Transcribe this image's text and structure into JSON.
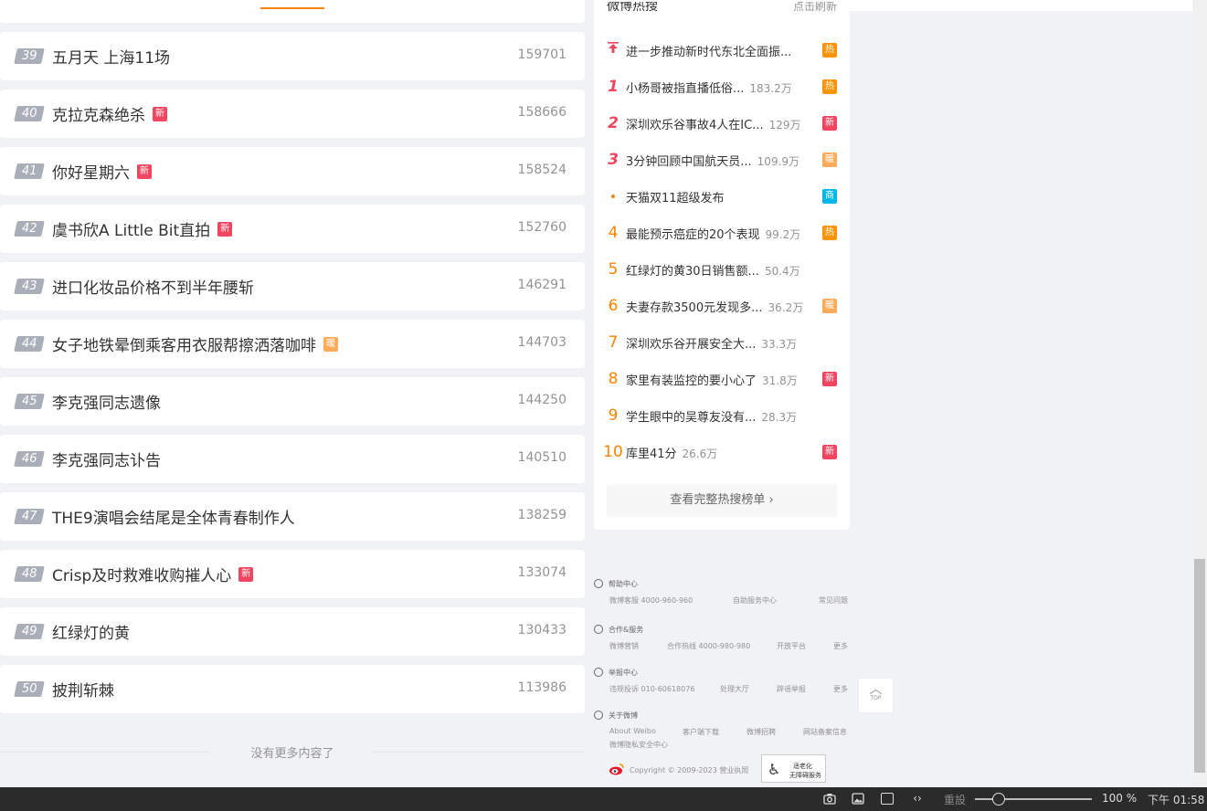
{
  "list": {
    "rows": [
      {
        "rank": "39",
        "title": "五月天 上海11场",
        "badge": "",
        "badge_type": "",
        "count": "159701"
      },
      {
        "rank": "40",
        "title": "克拉克森绝杀",
        "badge": "新",
        "badge_type": "b-new",
        "count": "158666"
      },
      {
        "rank": "41",
        "title": "你好星期六",
        "badge": "新",
        "badge_type": "b-new",
        "count": "158524"
      },
      {
        "rank": "42",
        "title": "虞书欣A Little Bit直拍",
        "badge": "新",
        "badge_type": "b-new",
        "count": "152760"
      },
      {
        "rank": "43",
        "title": "进口化妆品价格不到半年腰斩",
        "badge": "",
        "badge_type": "",
        "count": "146291"
      },
      {
        "rank": "44",
        "title": "女子地铁晕倒乘客用衣服帮擦洒落咖啡",
        "badge": "暖",
        "badge_type": "b-warm",
        "count": "144703"
      },
      {
        "rank": "45",
        "title": "李克强同志遗像",
        "badge": "",
        "badge_type": "",
        "count": "144250"
      },
      {
        "rank": "46",
        "title": "李克强同志讣告",
        "badge": "",
        "badge_type": "",
        "count": "140510"
      },
      {
        "rank": "47",
        "title": "THE9演唱会结尾是全体青春制作人",
        "badge": "",
        "badge_type": "",
        "count": "138259"
      },
      {
        "rank": "48",
        "title": "Crisp及时救难收购摧人心",
        "badge": "新",
        "badge_type": "b-new",
        "count": "133074"
      },
      {
        "rank": "49",
        "title": "红绿灯的黄",
        "badge": "",
        "badge_type": "",
        "count": "130433"
      },
      {
        "rank": "50",
        "title": "披荆斩棘",
        "badge": "",
        "badge_type": "",
        "count": "113986"
      }
    ],
    "end_text": "没有更多内容了"
  },
  "hot_search": {
    "heading": "微博热搜",
    "refresh": "点击刷新",
    "items": [
      {
        "num": "",
        "kind": "up",
        "text": "进一步推动新时代东北全面振...",
        "cnt": "",
        "badge": "热",
        "badge_type": "b-hot"
      },
      {
        "num": "1",
        "kind": "r1",
        "text": "小杨哥被指直播低俗...",
        "cnt": "183.2万",
        "badge": "热",
        "badge_type": "b-hot"
      },
      {
        "num": "2",
        "kind": "r1",
        "text": "深圳欢乐谷事故4人在IC...",
        "cnt": "129万",
        "badge": "新",
        "badge_type": "b-new"
      },
      {
        "num": "3",
        "kind": "r1",
        "text": "3分钟回顾中国航天员...",
        "cnt": "109.9万",
        "badge": "暖",
        "badge_type": "b-warm"
      },
      {
        "num": "",
        "kind": "dot",
        "text": "天猫双11超级发布",
        "cnt": "",
        "badge": "商",
        "badge_type": "b-ad"
      },
      {
        "num": "4",
        "kind": "rn",
        "text": "最能预示癌症的20个表现",
        "cnt": "99.2万",
        "badge": "热",
        "badge_type": "b-hot"
      },
      {
        "num": "5",
        "kind": "rn",
        "text": "红绿灯的黄30日销售额...",
        "cnt": "50.4万",
        "badge": "",
        "badge_type": ""
      },
      {
        "num": "6",
        "kind": "rn",
        "text": "夫妻存款3500元发现多...",
        "cnt": "36.2万",
        "badge": "暖",
        "badge_type": "b-warm"
      },
      {
        "num": "7",
        "kind": "rn",
        "text": "深圳欢乐谷开展安全大...",
        "cnt": "33.3万",
        "badge": "",
        "badge_type": ""
      },
      {
        "num": "8",
        "kind": "rn",
        "text": "家里有装监控的要小心了",
        "cnt": "31.8万",
        "badge": "新",
        "badge_type": "b-new"
      },
      {
        "num": "9",
        "kind": "rn",
        "text": "学生眼中的吴尊友没有...",
        "cnt": "28.3万",
        "badge": "",
        "badge_type": ""
      },
      {
        "num": "10",
        "kind": "rn",
        "text": "库里41分",
        "cnt": "26.6万",
        "badge": "新",
        "badge_type": "b-new"
      }
    ],
    "more": "查看完整热搜榜单 ›"
  },
  "footer": {
    "help": {
      "title": "帮助中心",
      "links": [
        "微博客服 4000-960-960",
        "自助服务中心",
        "常见问题"
      ]
    },
    "coop": {
      "title": "合作&服务",
      "links": [
        "微博营销",
        "合作热线 4000-980-980",
        "开放平台",
        "更多"
      ]
    },
    "report": {
      "title": "举报中心",
      "links": [
        "违规投诉 010-60618076",
        "处理大厅",
        "辟谣举报",
        "更多"
      ]
    },
    "about": {
      "title": "关于微博",
      "links": [
        "About Weibo",
        "客户端下载",
        "微博招聘",
        "网站备案信息"
      ],
      "links2": [
        "微博隐私安全中心"
      ]
    },
    "copyright": "Copyright © 2009-2023 营业执照",
    "access_1": "适老化",
    "access_2": "无障碍服务"
  },
  "top_button": "TOP",
  "status_bar": {
    "reset": "重設",
    "zoom": "100 %",
    "time": "下午 01:58"
  }
}
